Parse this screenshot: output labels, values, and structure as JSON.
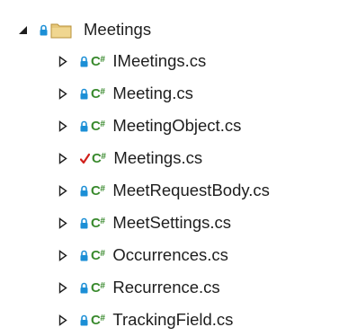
{
  "explorer": {
    "folder": {
      "label": "Meetings",
      "expanded": true,
      "source_control": "locked"
    },
    "file_icon_text": "C#",
    "files": [
      {
        "label": "IMeetings.cs",
        "source_control": "locked"
      },
      {
        "label": "Meeting.cs",
        "source_control": "locked"
      },
      {
        "label": "MeetingObject.cs",
        "source_control": "locked"
      },
      {
        "label": "Meetings.cs",
        "source_control": "checked-out"
      },
      {
        "label": "MeetRequestBody.cs",
        "source_control": "locked"
      },
      {
        "label": "MeetSettings.cs",
        "source_control": "locked"
      },
      {
        "label": "Occurrences.cs",
        "source_control": "locked"
      },
      {
        "label": "Recurrence.cs",
        "source_control": "locked"
      },
      {
        "label": "TrackingField.cs",
        "source_control": "locked"
      }
    ]
  },
  "colors": {
    "lock": "#1c8fd6",
    "checkout": "#d0201b",
    "csharp": "#3a8a2e",
    "folder": "#d9b35c",
    "text": "#1e1e1e"
  }
}
